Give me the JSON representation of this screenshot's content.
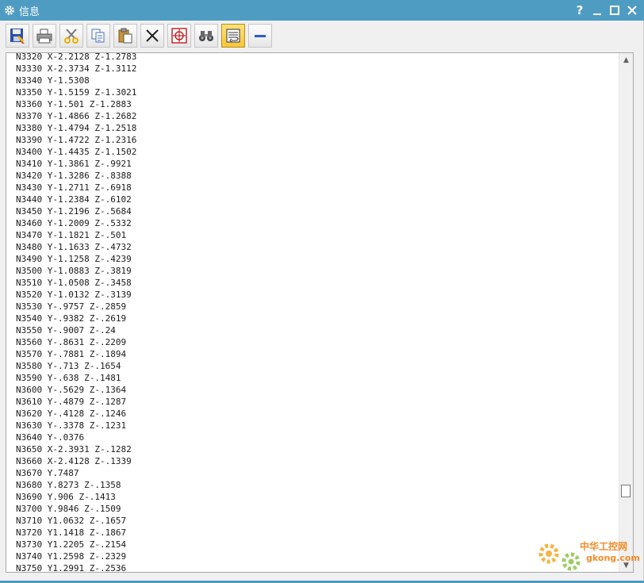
{
  "window": {
    "title": "信息",
    "help_label": "?",
    "minimize_label": "_",
    "close_label": "✕"
  },
  "toolbar": {
    "buttons": [
      "save-icon",
      "print-icon",
      "cut-icon",
      "copy-icon",
      "paste-icon",
      "delete-icon",
      "target-icon",
      "binoculars-icon",
      "wrap-icon",
      "minus-icon"
    ]
  },
  "listing": [
    "N3320 X-2.2128 Z-1.2783",
    "N3330 X-2.3734 Z-1.3112",
    "N3340 Y-1.5308",
    "N3350 Y-1.5159 Z-1.3021",
    "N3360 Y-1.501 Z-1.2883",
    "N3370 Y-1.4866 Z-1.2682",
    "N3380 Y-1.4794 Z-1.2518",
    "N3390 Y-1.4722 Z-1.2316",
    "N3400 Y-1.4435 Z-1.1502",
    "N3410 Y-1.3861 Z-.9921",
    "N3420 Y-1.3286 Z-.8388",
    "N3430 Y-1.2711 Z-.6918",
    "N3440 Y-1.2384 Z-.6102",
    "N3450 Y-1.2196 Z-.5684",
    "N3460 Y-1.2009 Z-.5332",
    "N3470 Y-1.1821 Z-.501",
    "N3480 Y-1.1633 Z-.4732",
    "N3490 Y-1.1258 Z-.4239",
    "N3500 Y-1.0883 Z-.3819",
    "N3510 Y-1.0508 Z-.3458",
    "N3520 Y-1.0132 Z-.3139",
    "N3530 Y-.9757 Z-.2859",
    "N3540 Y-.9382 Z-.2619",
    "N3550 Y-.9007 Z-.24",
    "N3560 Y-.8631 Z-.2209",
    "N3570 Y-.7881 Z-.1894",
    "N3580 Y-.713 Z-.1654",
    "N3590 Y-.638 Z-.1481",
    "N3600 Y-.5629 Z-.1364",
    "N3610 Y-.4879 Z-.1287",
    "N3620 Y-.4128 Z-.1246",
    "N3630 Y-.3378 Z-.1231",
    "N3640 Y-.0376",
    "N3650 X-2.3931 Z-.1282",
    "N3660 X-2.4128 Z-.1339",
    "N3670 Y.7487",
    "N3680 Y.8273 Z-.1358",
    "N3690 Y.906 Z-.1413",
    "N3700 Y.9846 Z-.1509",
    "N3710 Y1.0632 Z-.1657",
    "N3720 Y1.1418 Z-.1867",
    "N3730 Y1.2205 Z-.2154",
    "N3740 Y1.2598 Z-.2329",
    "N3750 Y1.2991 Z-.2536"
  ],
  "watermark": {
    "cn": "中华工控网",
    "url": "gkong.com"
  },
  "colors": {
    "titlebar": "#4f9cc3",
    "active_button": "#f7c63a",
    "watermark": "#f28c28"
  }
}
